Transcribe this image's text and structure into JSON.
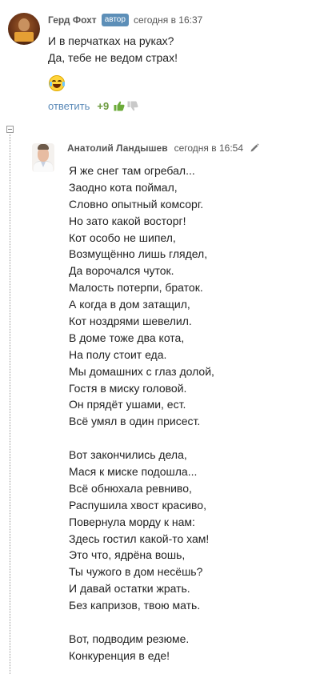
{
  "comment1": {
    "author": "Герд Фохт",
    "badge": "автор",
    "time": "сегодня в 16:37",
    "lines": [
      "И в перчатках на руках?",
      "Да, тебе не ведом страх!"
    ],
    "emoji": "laughing-tears-emoji",
    "reply_label": "ответить",
    "score": "+9",
    "colors": {
      "score": "#6b9a3e",
      "link": "#5b8ab8",
      "badge_bg": "#5d8fb8"
    }
  },
  "comment2": {
    "author": "Анатолий Ландышев",
    "time": "сегодня в 16:54",
    "poem": [
      "Я же снег там огребал...",
      "Заодно кота поймал,",
      "Словно опытный комсорг.",
      "Но зато какой восторг!",
      "Кот особо не шипел,",
      "Возмущённо лишь глядел,",
      "Да ворочался чуток.",
      "Малость потерпи, браток.",
      "А когда в дом затащил,",
      "Кот ноздрями шевелил.",
      "В доме тоже два кота,",
      "На полу стоит еда.",
      "Мы домашних с глаз долой,",
      "Гостя в миску головой.",
      "Он прядёт ушами, ест.",
      "Всё умял в один присест.",
      "",
      "Вот закончились дела,",
      "Мася к миске подошла...",
      "Всё обнюхала ревниво,",
      "Распушила хвост красиво,",
      "Повернула морду к нам:",
      "Здесь гостил какой-то хам!",
      "Это что, ядрёна вошь,",
      "Ты чужого в дом несёшь?",
      "И давай остатки жрать.",
      "Без капризов, твою мать.",
      "",
      "Вот, подводим резюме.",
      "Конкуренция в еде!"
    ]
  }
}
